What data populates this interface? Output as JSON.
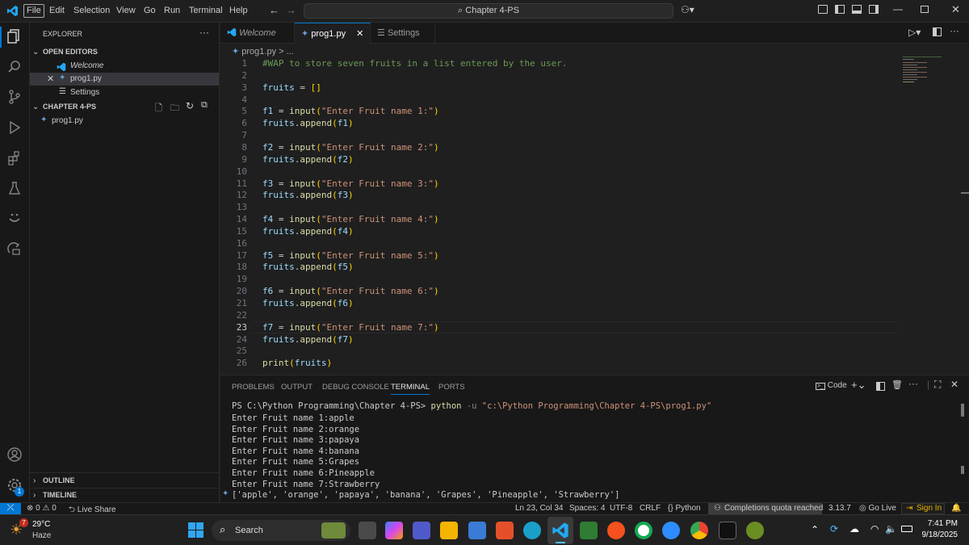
{
  "menu": {
    "file": "File",
    "edit": "Edit",
    "selection": "Selection",
    "view": "View",
    "go": "Go",
    "run": "Run",
    "terminal": "Terminal",
    "help": "Help"
  },
  "command_center": "Chapter 4-PS",
  "sidebar": {
    "title": "EXPLORER",
    "open_editors": "OPEN EDITORS",
    "open_files": [
      "Welcome",
      "prog1.py",
      "Settings"
    ],
    "folder": "CHAPTER 4-PS",
    "folder_files": [
      "prog1.py"
    ],
    "outline": "OUTLINE",
    "timeline": "TIMELINE"
  },
  "tabs": [
    "Welcome",
    "prog1.py",
    "Settings"
  ],
  "breadcrumb": "prog1.py > ...",
  "code_lines": [
    "#WAP to store seven fruits in a list entered by the user.",
    "",
    "fruits = []",
    "",
    "f1 = input(\"Enter Fruit name 1:\")",
    "fruits.append(f1)",
    "",
    "f2 = input(\"Enter Fruit name 2:\")",
    "fruits.append(f2)",
    "",
    "f3 = input(\"Enter Fruit name 3:\")",
    "fruits.append(f3)",
    "",
    "f4 = input(\"Enter Fruit name 4:\")",
    "fruits.append(f4)",
    "",
    "f5 = input(\"Enter Fruit name 5:\")",
    "fruits.append(f5)",
    "",
    "f6 = input(\"Enter Fruit name 6:\")",
    "fruits.append(f6)",
    "",
    "f7 = input(\"Enter Fruit name 7:\")",
    "fruits.append(f7)",
    "",
    "print(fruits)"
  ],
  "active_line": 23,
  "panel": {
    "tabs": [
      "PROBLEMS",
      "OUTPUT",
      "DEBUG CONSOLE",
      "TERMINAL",
      "PORTS"
    ],
    "active_tab": "TERMINAL",
    "shell_label": "Code",
    "prompt": "PS C:\\Python Programming\\Chapter 4-PS>",
    "command": "python",
    "command_flag": "-u",
    "command_arg": "\"c:\\Python Programming\\Chapter 4-PS\\prog1.py\"",
    "output": [
      "Enter Fruit name 1:apple",
      "Enter Fruit name 2:orange",
      "Enter Fruit name 3:papaya",
      "Enter Fruit name 4:banana",
      "Enter Fruit name 5:Grapes",
      "Enter Fruit name 6:Pineapple",
      "Enter Fruit name 7:Strawberry",
      "['apple', 'orange', 'papaya', 'banana', 'Grapes', 'Pineapple', 'Strawberry']"
    ]
  },
  "status": {
    "errors": "0",
    "warnings": "0",
    "live_share": "Live Share",
    "position": "Ln 23, Col 34",
    "spaces": "Spaces: 4",
    "encoding": "UTF-8",
    "eol": "CRLF",
    "language": "Python",
    "copilot": "Completions quota reached",
    "py_version": "3.13.7",
    "go_live": "Go Live",
    "sign_in": "Sign In"
  },
  "taskbar": {
    "weather_temp": "29°C",
    "weather_desc": "Haze",
    "weather_badge": "7",
    "search": "Search",
    "time": "7:41 PM",
    "date": "9/18/2025"
  },
  "colors": {
    "accent": "#0078d4",
    "vscode_blue": "#23a8f2",
    "sign_in_bg": "#1e1e1e"
  }
}
